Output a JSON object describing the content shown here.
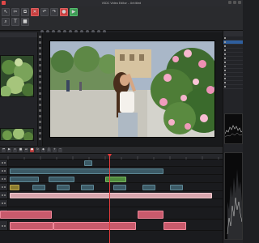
{
  "window": {
    "title": "VSDC Video Editor – Untitled"
  },
  "colors": {
    "accent": "#e63b3b",
    "timeline_video_clip": "#3c5a66",
    "timeline_audio_clip": "#c85a6c",
    "selected_row": "#2f5f9e"
  },
  "toolbar": {
    "icons": [
      "cursor-icon",
      "cut-icon",
      "copy-icon",
      "paste-icon",
      "delete-icon",
      "undo-icon",
      "redo-icon",
      "zoom-icon",
      "text-icon",
      "shape-icon",
      "record-icon",
      "export-icon"
    ]
  },
  "transport": {
    "icons": [
      "skip-back-icon",
      "play-icon",
      "pause-icon",
      "stop-icon",
      "skip-forward-icon",
      "record-icon",
      "loop-icon",
      "marker-icon"
    ]
  },
  "right_panel": {
    "rows": [
      "",
      "",
      "",
      "",
      "",
      "",
      "",
      "",
      "",
      "",
      "",
      "",
      "",
      ""
    ]
  },
  "preview": {
    "description_icon": "video-preview"
  }
}
